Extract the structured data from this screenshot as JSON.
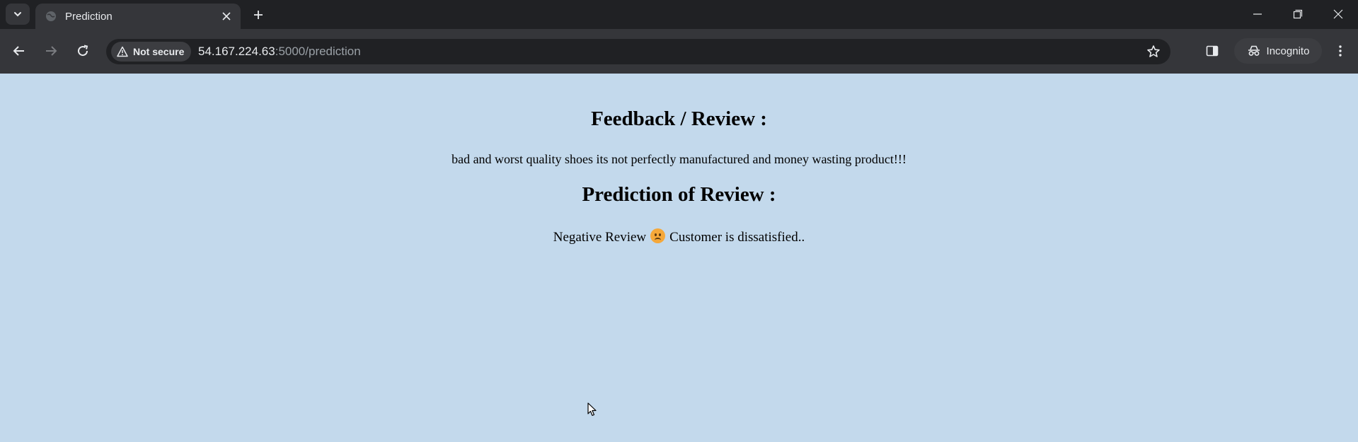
{
  "browser": {
    "tab": {
      "title": "Prediction"
    },
    "toolbar": {
      "security_label": "Not secure",
      "url_host": "54.167.224.63",
      "url_path": ":5000/prediction",
      "incognito_label": "Incognito"
    }
  },
  "page": {
    "feedback_heading": "Feedback / Review :",
    "review_text": "bad and worst quality shoes its not perfectly manufactured and money wasting product!!!",
    "prediction_heading": "Prediction of Review :",
    "prediction_label": "Negative Review",
    "prediction_emoji": "frowning-face",
    "prediction_detail": "Customer is dissatisfied.."
  },
  "colors": {
    "page_background": "#c3d9ec",
    "chrome_dark": "#202124",
    "chrome_toolbar": "#35363a"
  }
}
